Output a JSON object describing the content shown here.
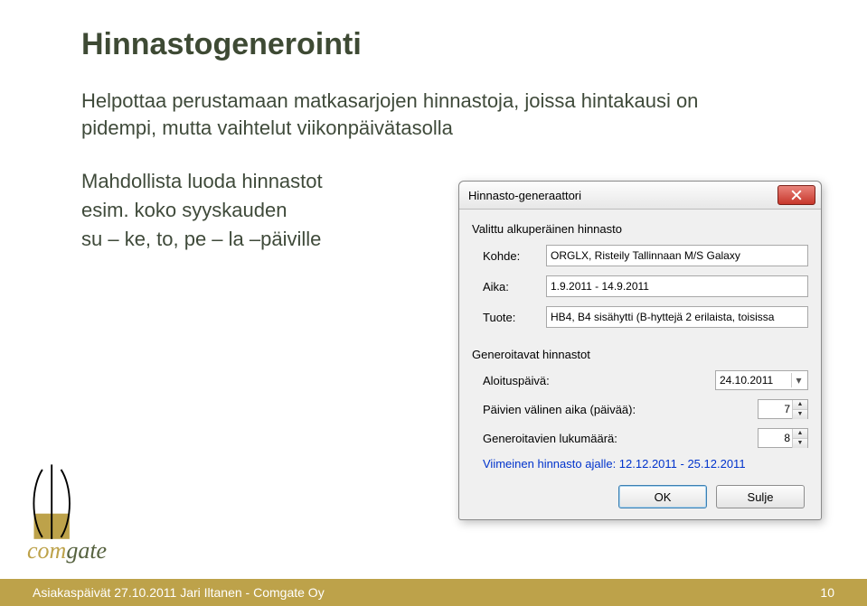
{
  "slide": {
    "title": "Hinnastogenerointi",
    "lead": "Helpottaa perustamaan matkasarjojen hinnastoja, joissa hintakausi on pidempi, mutta vaihtelut viikonpäivätasolla",
    "left1": "Mahdollista luoda hinnastot",
    "left2": "esim. koko syyskauden",
    "left3": "su – ke, to, pe – la –päiville"
  },
  "dialog": {
    "title": "Hinnasto-generaattori",
    "group1": "Valittu alkuperäinen hinnasto",
    "kohde_label": "Kohde:",
    "kohde_value": "ORGLX, Risteily Tallinnaan M/S Galaxy",
    "aika_label": "Aika:",
    "aika_value": "1.9.2011 - 14.9.2011",
    "tuote_label": "Tuote:",
    "tuote_value": "HB4, B4 sisähytti (B-hyttejä 2 erilaista, toisissa",
    "group2": "Generoitavat hinnastot",
    "aloitus_label": "Aloituspäivä:",
    "aloitus_value": "24.10.2011",
    "interval_label": "Päivien välinen aika (päivää):",
    "interval_value": "7",
    "count_label": "Generoitavien lukumäärä:",
    "count_value": "8",
    "blue_note": "Viimeinen hinnasto ajalle: 12.12.2011 - 25.12.2011",
    "ok": "OK",
    "close": "Sulje"
  },
  "logo": {
    "brand1": "com",
    "brand2": "gate"
  },
  "footer": {
    "left": "Asiakaspäivät 27.10.2011 Jari Iltanen - Comgate Oy",
    "page": "10"
  }
}
